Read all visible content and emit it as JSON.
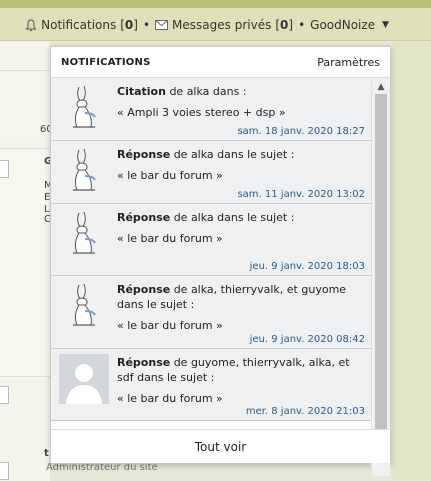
{
  "topnav": {
    "notifications_label": "Notifications",
    "notifications_count": "0",
    "messages_label": "Messages privés",
    "messages_count": "0",
    "separator": "•",
    "username": "GoodNoize"
  },
  "background": {
    "frag1": "60",
    "frag2": "G",
    "frag3": "M",
    "frag4": "E",
    "frag5": "L",
    "frag6": "C",
    "frag7": "t",
    "admin_text": "Administrateur du site"
  },
  "dropdown": {
    "title": "NOTIFICATIONS",
    "settings": "Paramètres",
    "footer": "Tout voir",
    "items": [
      {
        "type": "Citation",
        "text": " de alka dans :",
        "subject": "« Ampli 3 voies stereo + dsp »",
        "time": "sam. 18 janv. 2020 18:27",
        "avatar": "rabbit"
      },
      {
        "type": "Réponse",
        "text": " de alka dans le sujet :",
        "subject": "« le bar du forum »",
        "time": "sam. 11 janv. 2020 13:02",
        "avatar": "rabbit"
      },
      {
        "type": "Réponse",
        "text": " de alka dans le sujet :",
        "subject": "« le bar du forum »",
        "time": "jeu. 9 janv. 2020 18:03",
        "avatar": "rabbit"
      },
      {
        "type": "Réponse",
        "text": " de alka, thierryvalk, et guyome dans le sujet :",
        "subject": "« le bar du forum »",
        "time": "jeu. 9 janv. 2020 08:42",
        "avatar": "rabbit"
      },
      {
        "type": "Réponse",
        "text": " de guyome, thierryvalk, alka, et sdf dans le sujet :",
        "subject": "« le bar du forum »",
        "time": "mer. 8 janv. 2020 21:03",
        "avatar": "default-user"
      }
    ]
  },
  "icons": {
    "bell": "bell-icon",
    "envelope": "envelope-icon",
    "caret": "caret-down-icon"
  }
}
